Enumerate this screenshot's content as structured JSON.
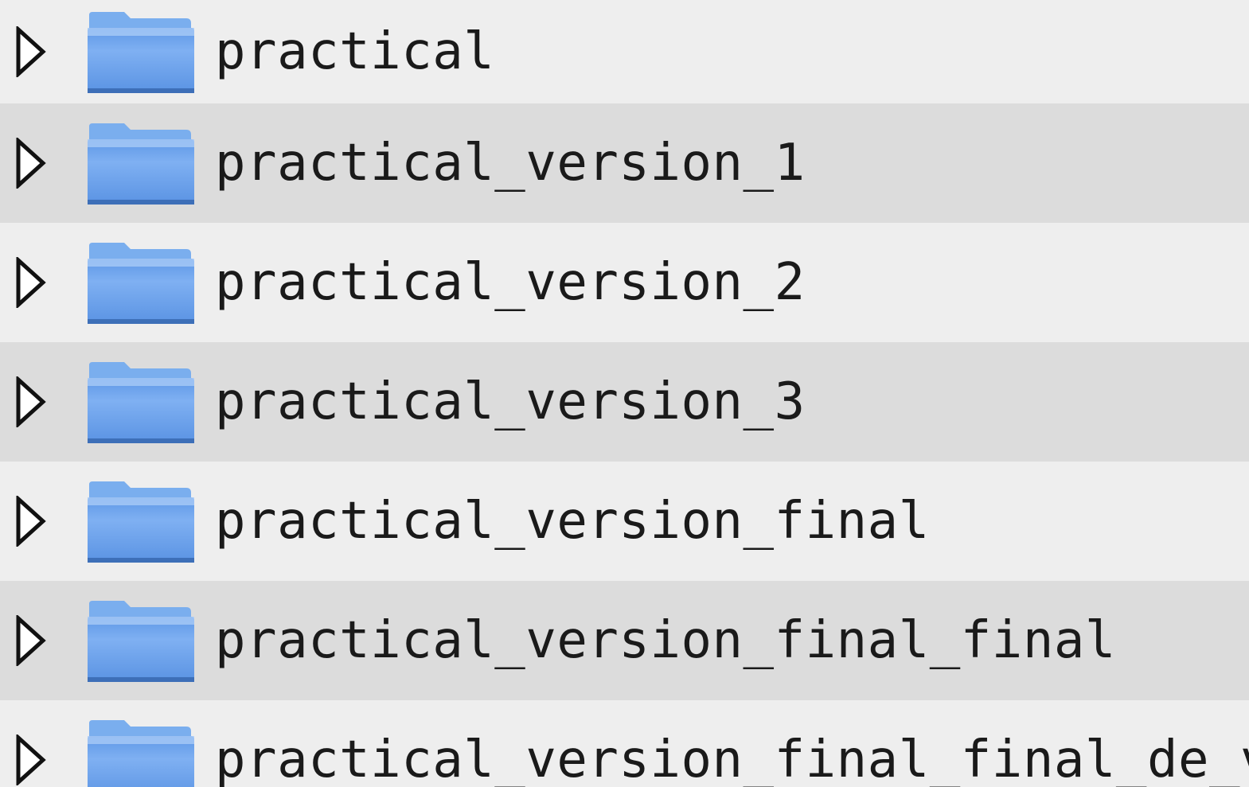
{
  "file_tree": {
    "items": [
      {
        "label": "practical",
        "icon": "folder-icon",
        "expander": "chevron-right-icon"
      },
      {
        "label": "practical_version_1",
        "icon": "folder-icon",
        "expander": "chevron-right-icon"
      },
      {
        "label": "practical_version_2",
        "icon": "folder-icon",
        "expander": "chevron-right-icon"
      },
      {
        "label": "practical_version_3",
        "icon": "folder-icon",
        "expander": "chevron-right-icon"
      },
      {
        "label": "practical_version_final",
        "icon": "folder-icon",
        "expander": "chevron-right-icon"
      },
      {
        "label": "practical_version_final_final",
        "icon": "folder-icon",
        "expander": "chevron-right-icon"
      },
      {
        "label": "practical_version_final_final_de_verdad",
        "icon": "folder-icon",
        "expander": "chevron-right-icon"
      }
    ]
  },
  "colors": {
    "row_light": "#eeeeee",
    "row_dark": "#dcdcdc",
    "folder_top": "#8fb8f0",
    "folder_body": "#6aa2ec",
    "folder_edge": "#4a7fc9",
    "text": "#1a1a1a"
  }
}
